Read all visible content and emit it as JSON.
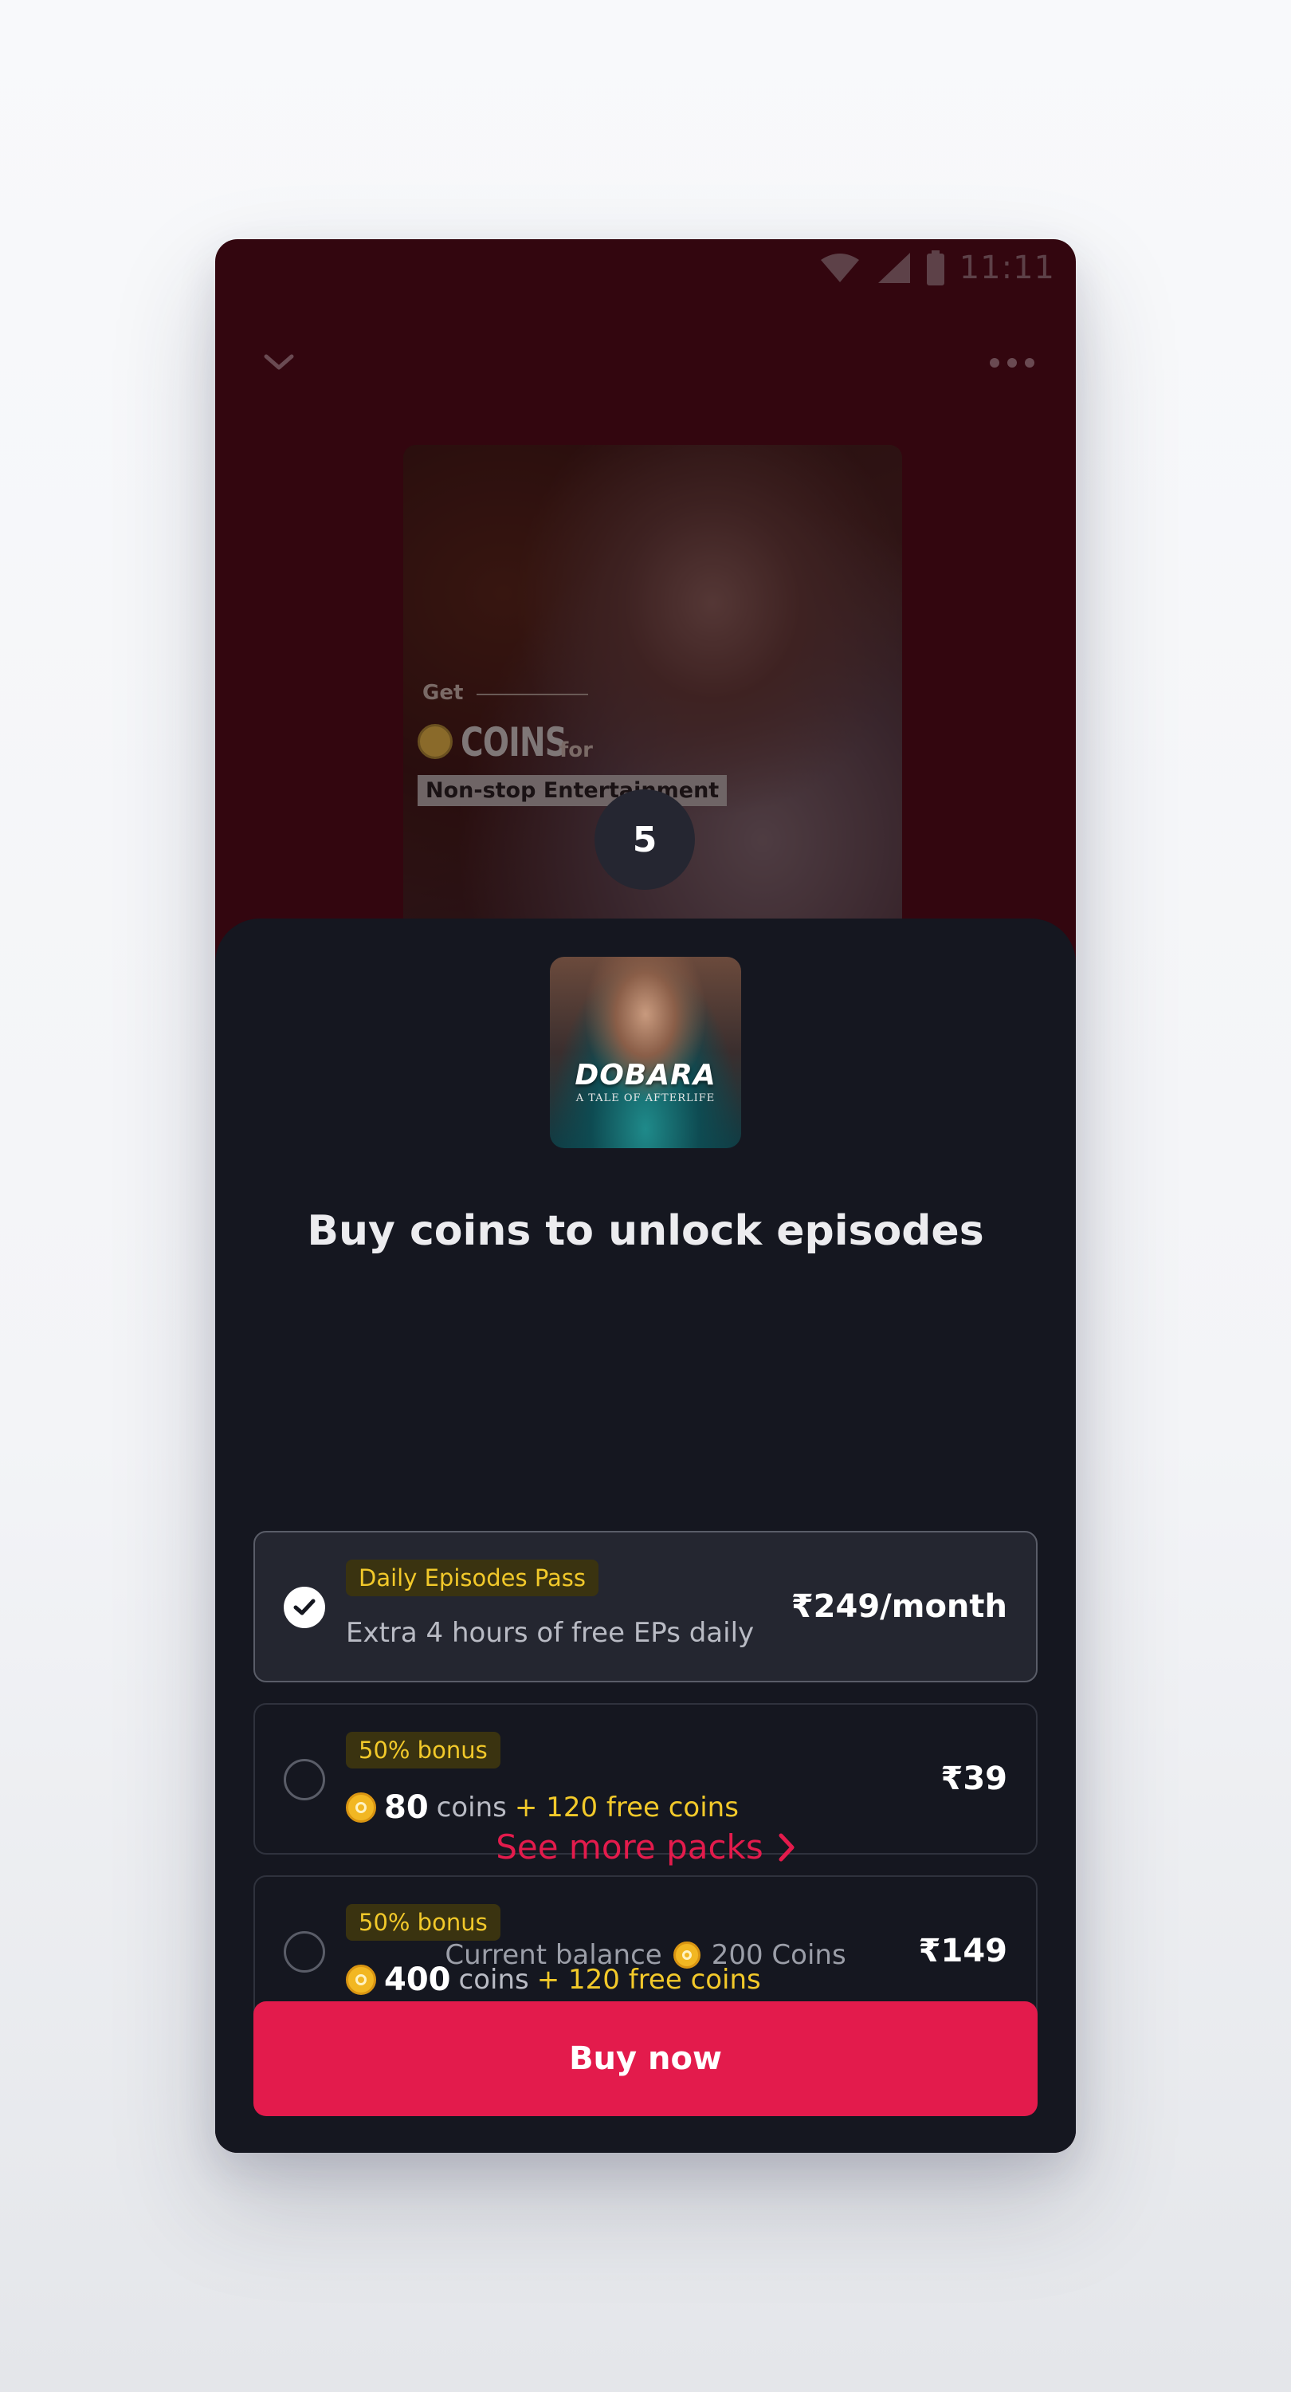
{
  "status_bar": {
    "time": "11:11"
  },
  "poster": {
    "get_text": "Get",
    "coins_text": "COINS",
    "for_text": "for",
    "tag_text": "Non-stop Entertainment",
    "episode_number": "5"
  },
  "sheet": {
    "cover": {
      "title": "DOBARA",
      "subtitle": "A TALE OF AFTERLIFE"
    },
    "title": "Buy coins to unlock episodes",
    "packs": [
      {
        "tag": "Daily Episodes Pass",
        "description": "Extra 4 hours of free EPs daily",
        "price": "₹249/month",
        "selected": true
      },
      {
        "tag": "50% bonus",
        "coins": "80",
        "coins_label": "coins",
        "bonus": "+ 120 free coins",
        "price": "₹39",
        "selected": false
      },
      {
        "tag": "50% bonus",
        "coins": "400",
        "coins_label": "coins",
        "bonus": "+ 120 free coins",
        "price": "₹149",
        "selected": false
      }
    ],
    "see_more": "See more packs",
    "balance_label": "Current balance",
    "balance_value": "200 Coins",
    "buy_label": "Buy now"
  },
  "colors": {
    "accent": "#e31b4c",
    "gold": "#f2c92a",
    "sheet_bg": "#151720",
    "backdrop": "#33060f"
  }
}
